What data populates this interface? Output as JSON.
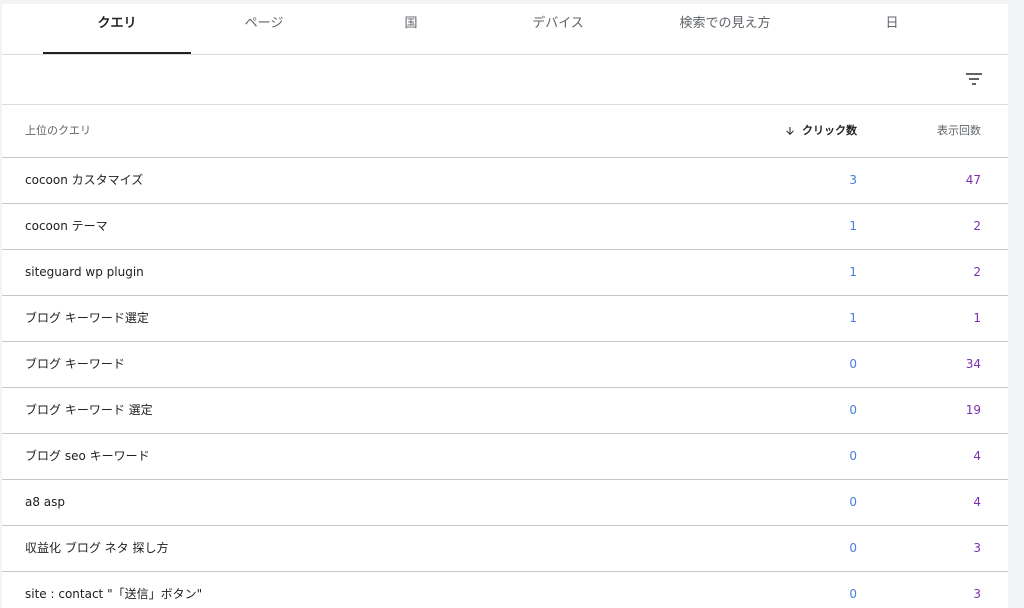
{
  "tabs": [
    {
      "label": "クエリ",
      "active": true
    },
    {
      "label": "ページ",
      "active": false
    },
    {
      "label": "国",
      "active": false
    },
    {
      "label": "デバイス",
      "active": false
    },
    {
      "label": "検索での見え方",
      "active": false
    },
    {
      "label": "日",
      "active": false
    }
  ],
  "filter": {
    "icon": "filter-list-icon"
  },
  "table": {
    "headers": {
      "query": "上位のクエリ",
      "clicks": "クリック数",
      "impressions": "表示回数",
      "sort_icon": "arrow-downward-icon"
    },
    "rows": [
      {
        "query": "cocoon カスタマイズ",
        "clicks": "3",
        "impressions": "47"
      },
      {
        "query": "cocoon テーマ",
        "clicks": "1",
        "impressions": "2"
      },
      {
        "query": "siteguard wp plugin",
        "clicks": "1",
        "impressions": "2"
      },
      {
        "query": "ブログ キーワード選定",
        "clicks": "1",
        "impressions": "1"
      },
      {
        "query": "ブログ キーワード",
        "clicks": "0",
        "impressions": "34"
      },
      {
        "query": "ブログ キーワード 選定",
        "clicks": "0",
        "impressions": "19"
      },
      {
        "query": "ブログ seo キーワード",
        "clicks": "0",
        "impressions": "4"
      },
      {
        "query": "a8 asp",
        "clicks": "0",
        "impressions": "4"
      },
      {
        "query": "収益化 ブログ ネタ 探し方",
        "clicks": "0",
        "impressions": "3"
      },
      {
        "query": "site : contact \"「送信」ボタン\"",
        "clicks": "0",
        "impressions": "3"
      }
    ]
  },
  "colors": {
    "clicks": "#4a7ee0",
    "impressions": "#7b2fb5",
    "active_tab": "#202124"
  }
}
